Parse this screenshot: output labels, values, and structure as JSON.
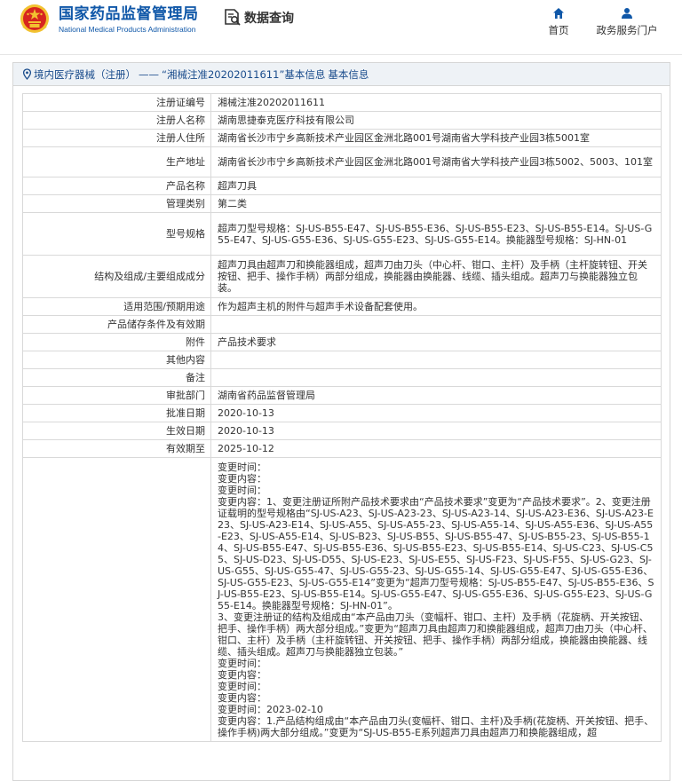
{
  "header": {
    "brand_cn": "国家药品监督管理局",
    "brand_en": "National Medical Products Administration",
    "section": "数据查询",
    "nav": {
      "home": "首页",
      "portal": "政务服务门户"
    },
    "colors": {
      "brand": "#0f57a8",
      "emblem_red": "#d7261f",
      "emblem_gold": "#f2c230"
    },
    "icons": {
      "emblem": "national-emblem",
      "section": "search-document-icon",
      "home": "home-icon",
      "portal": "user-icon"
    }
  },
  "breadcrumb": {
    "category": "境内医疗器械（注册）",
    "separator": "——",
    "record": "“湘械注准20202011611”基本信息"
  },
  "rows": [
    {
      "label": "注册证编号",
      "value": "湘械注准20202011611"
    },
    {
      "label": "注册人名称",
      "value": "湖南思捷泰克医疗科技有限公司"
    },
    {
      "label": "注册人住所",
      "value": "湖南省长沙市宁乡高新技术产业园区金洲北路001号湖南省大学科技产业园3栋5001室"
    },
    {
      "label": "生产地址",
      "value": "湖南省长沙市宁乡高新技术产业园区金洲北路001号湖南省大学科技产业园3栋5002、5003、101室"
    },
    {
      "label": "产品名称",
      "value": "超声刀具"
    },
    {
      "label": "管理类别",
      "value": "第二类"
    },
    {
      "label": "型号规格",
      "value": "超声刀型号规格：SJ-US-B55-E47、SJ-US-B55-E36、SJ-US-B55-E23、SJ-US-B55-E14。SJ-US-G55-E47、SJ-US-G55-E36、SJ-US-G55-E23、SJ-US-G55-E14。换能器型号规格：SJ-HN-01"
    },
    {
      "label": "结构及组成/主要组成成分",
      "value": "超声刀具由超声刀和换能器组成，超声刀由刀头（中心杆、钳口、主杆）及手柄（主杆旋转钮、开关按钮、把手、操作手柄）两部分组成，换能器由换能器、线缆、插头组成。超声刀与换能器独立包装。"
    },
    {
      "label": "适用范围/预期用途",
      "value": "作为超声主机的附件与超声手术设备配套使用。"
    },
    {
      "label": "产品储存条件及有效期",
      "value": ""
    },
    {
      "label": "附件",
      "value": "产品技术要求"
    },
    {
      "label": "其他内容",
      "value": ""
    },
    {
      "label": "备注",
      "value": ""
    },
    {
      "label": "审批部门",
      "value": "湖南省药品监督管理局"
    },
    {
      "label": "批准日期",
      "value": "2020-10-13"
    },
    {
      "label": "生效日期",
      "value": "2020-10-13"
    },
    {
      "label": "有效期至",
      "value": "2025-10-12"
    },
    {
      "label": "",
      "value": "变更时间：\n变更内容：\n变更时间：\n变更内容：1、变更注册证所附产品技术要求由“产品技术要求”变更为“产品技术要求”。2、变更注册证载明的型号规格由“SJ-US-A23、SJ-US-A23-23、SJ-US-A23-14、SJ-US-A23-E36、SJ-US-A23-E23、SJ-US-A23-E14、SJ-US-A55、SJ-US-A55-23、SJ-US-A55-14、SJ-US-A55-E36、SJ-US-A55-E23、SJ-US-A55-E14、SJ-US-B23、SJ-US-B55、SJ-US-B55-47、SJ-US-B55-23、SJ-US-B55-14、SJ-US-B55-E47、SJ-US-B55-E36、SJ-US-B55-E23、SJ-US-B55-E14、SJ-US-C23、SJ-US-C55、SJ-US-D23、SJ-US-D55、SJ-US-E23、SJ-US-E55、SJ-US-F23、SJ-US-F55、SJ-US-G23、SJ-US-G55、SJ-US-G55-47、SJ-US-G55-23、SJ-US-G55-14、SJ-US-G55-E47、SJ-US-G55-E36、SJ-US-G55-E23、SJ-US-G55-E14”变更为“超声刀型号规格：SJ-US-B55-E47、SJ-US-B55-E36、SJ-US-B55-E23、SJ-US-B55-E14。SJ-US-G55-E47、SJ-US-G55-E36、SJ-US-G55-E23、SJ-US-G55-E14。换能器型号规格：SJ-HN-01”。\n3、变更注册证的结构及组成由“本产品由刀头（变幅杆、钳口、主杆）及手柄（花旋柄、开关按钮、把手、操作手柄）两大部分组成。”变更为“超声刀具由超声刀和换能器组成，超声刀由刀头（中心杆、钳口、主杆）及手柄（主杆旋转钮、开关按钮、把手、操作手柄）两部分组成，换能器由换能器、线缆、插头组成。超声刀与换能器独立包装。”\n变更时间：\n变更内容：\n变更时间：\n变更内容：\n变更时间：2023-02-10\n变更内容：1.产品结构组成由“本产品由刀头(变幅杆、钳口、主杆)及手柄(花旋柄、开关按钮、把手、操作手柄)两大部分组成。”变更为“SJ-US-B55-E系列超声刀具由超声刀和换能器组成，超"
    }
  ]
}
